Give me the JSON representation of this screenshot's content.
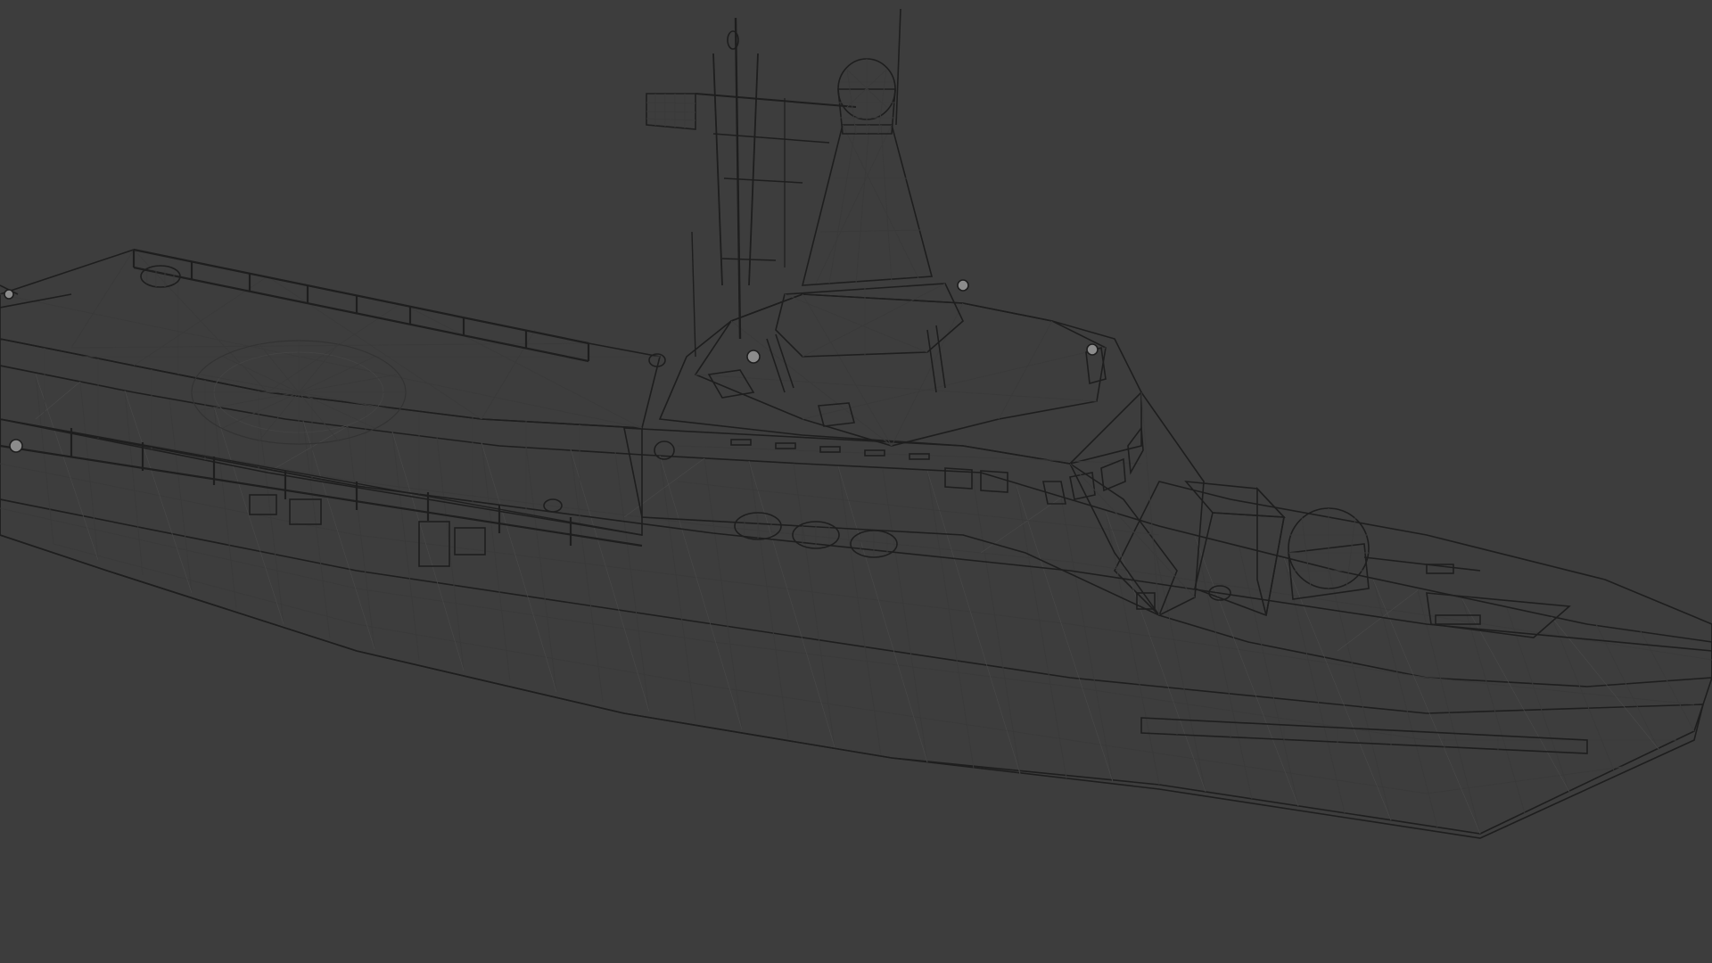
{
  "viewport": {
    "background_color": "#3d3d3d",
    "mesh_base_color": "#9a9a9a",
    "mesh_light_color": "#b4b4b4",
    "mesh_dark_color": "#7c7c7c",
    "wire_color": "#3a3a3a",
    "mode": "wireframe-on-solid"
  },
  "model": {
    "parts": [
      "hull",
      "flight-deck",
      "superstructure",
      "mast",
      "radar-dome",
      "bow-gun",
      "life-rafts",
      "deck-railing",
      "antenna-array"
    ]
  }
}
